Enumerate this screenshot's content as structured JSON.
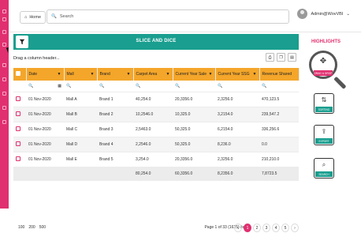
{
  "topbar": {
    "home_label": "Home",
    "search_placeholder": "Search",
    "user_name": "Admin@WovVBI"
  },
  "banner": {
    "title": "SLICE AND DICE"
  },
  "grid": {
    "drag_hint": "Drag a column header...",
    "columns": [
      "Date",
      "Mall",
      "Brand",
      "Carpet Area",
      "Current Year Sale",
      "Current Year SSG",
      "Revenue Shared"
    ],
    "rows": [
      [
        "01 Nov-2020",
        "Mall A",
        "Brand 1",
        "40,254.0",
        "20,3356.0",
        "2,3256.0",
        "470,123.5"
      ],
      [
        "01 Nov-2020",
        "Mall B",
        "Brand 2",
        "10,2546.0",
        "10,325.0",
        "3,2154.0",
        "239,547.2"
      ],
      [
        "01 Nov-2020",
        "Mall C",
        "Brand 3",
        "2,5463.0",
        "50,325.0",
        "6,2154.0",
        "336,256.6"
      ],
      [
        "01 Nov-2020",
        "Mall D",
        "Brand 4",
        "2,2546.0",
        "50,325.0",
        "8,236.0",
        "0.0"
      ],
      [
        "01 Nov-2020",
        "Mall E",
        "Brand 5",
        "3,254.0",
        "20,3356.0",
        "2,3256.0",
        "210,210.0"
      ]
    ],
    "totals": [
      "80,254.0",
      "60,3356.0",
      "8,2356.0",
      "7,8723.5"
    ]
  },
  "pager": {
    "sizes": [
      "100",
      "200",
      "500"
    ],
    "info": "Page 1 of 33 (1625) items",
    "pages": [
      "1",
      "2",
      "3",
      "4",
      "5"
    ]
  },
  "highlights": {
    "title": "HIGHLIGHTS",
    "items": [
      "DRAG & DROP",
      "SORTING",
      "EXPORT",
      "SEARCH"
    ]
  },
  "colors": {
    "accent": "#e0306f",
    "teal": "#1a9e8f",
    "header": "#f4a62a"
  }
}
